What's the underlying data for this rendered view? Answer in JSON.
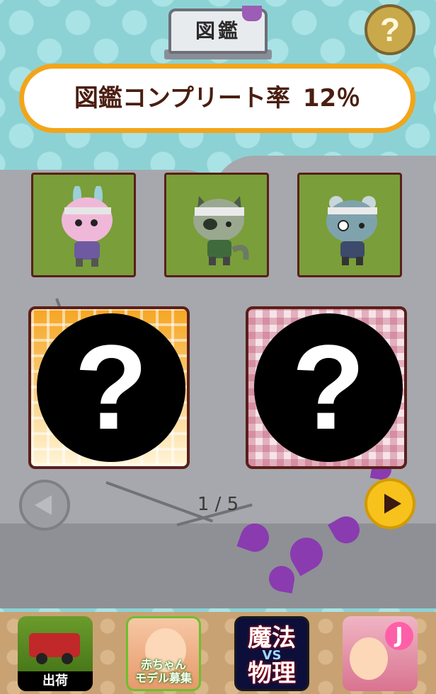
{
  "header": {
    "title": "図鑑",
    "help_label": "?"
  },
  "banner": {
    "label": "図鑑コンプリート率",
    "rate": "12％"
  },
  "collection": {
    "discovered": [
      {
        "icon": "bunny-zombie-icon"
      },
      {
        "icon": "raccoon-zombie-icon"
      },
      {
        "icon": "bear-zombie-icon"
      }
    ],
    "locked": [
      {
        "mark": "?",
        "pattern": "orange-plaid"
      },
      {
        "mark": "?",
        "pattern": "pink-gingham"
      }
    ]
  },
  "pagination": {
    "text": "1 / 5"
  },
  "ads": [
    {
      "label": "出荷"
    },
    {
      "label": "赤ちゃん\nモデル募集"
    },
    {
      "label": "魔法",
      "label2": "VS",
      "label3": "物理"
    },
    {
      "logo": "J"
    }
  ],
  "colors": {
    "banner_border": "#f2a51a",
    "next_button": "#f7c21b",
    "slot_bg": "#7a9e3a"
  }
}
